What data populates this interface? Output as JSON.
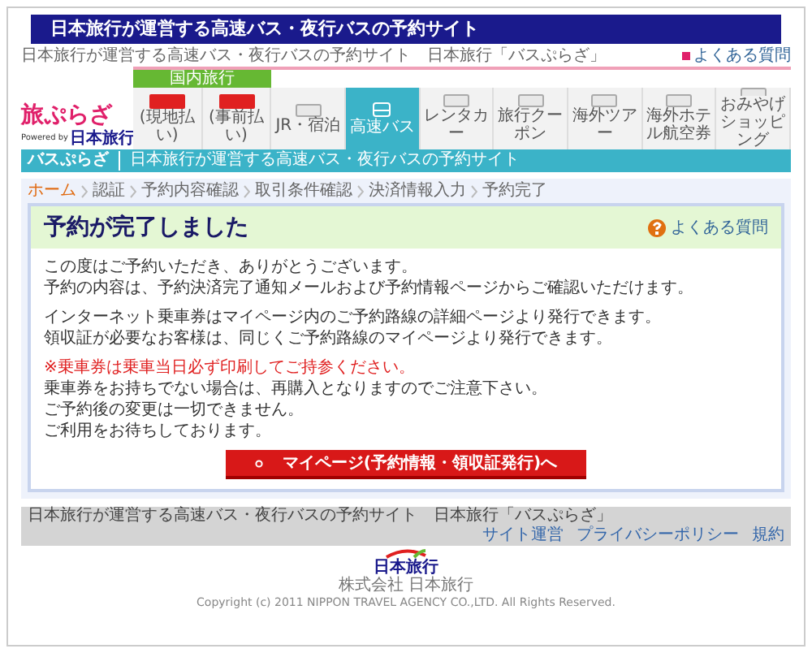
{
  "top_bar": {
    "title": "日本旅行が運営する高速バス・夜行バスの予約サイト"
  },
  "header": {
    "tagline": "日本旅行が運営する高速バス・夜行バスの予約サイト　日本旅行「バスぷらざ」",
    "faq_link": "よくある質問",
    "logo": "旅ぷらざ",
    "powered_by": "Powered by",
    "logo_brand": "日本旅行"
  },
  "nav": [
    {
      "kind": "group",
      "label": "国内旅行",
      "items": [
        {
          "kind": "badge",
          "label": "(現地払い)",
          "selected": false
        },
        {
          "kind": "badge",
          "label": "(事前払い)",
          "selected": false
        }
      ]
    },
    {
      "kind": "plain",
      "label": "JR・宿泊",
      "selected": false
    },
    {
      "kind": "bus",
      "label": "高速バス",
      "selected": true
    },
    {
      "kind": "plain",
      "label": "レンタカー",
      "selected": false
    },
    {
      "kind": "plain",
      "label": "旅行クーポン",
      "selected": false
    },
    {
      "kind": "plain",
      "label": "海外ツアー",
      "selected": false
    },
    {
      "kind": "plain",
      "label": "海外ホテル航空券",
      "selected": false
    },
    {
      "kind": "plain",
      "label": "おみやげショッピング",
      "selected": false
    }
  ],
  "sub_bar": {
    "site": "バスぷらざ",
    "description": "日本旅行が運営する高速バス・夜行バスの予約サイト"
  },
  "breadcrumb": [
    {
      "label": "ホーム",
      "link": true
    },
    {
      "label": "認証",
      "link": false
    },
    {
      "label": "予約内容確認",
      "link": false
    },
    {
      "label": "取引条件確認",
      "link": false
    },
    {
      "label": "決済情報入力",
      "link": false
    },
    {
      "label": "予約完了",
      "link": false
    }
  ],
  "card": {
    "title": "予約が完了しました",
    "faq_link": "よくある質問",
    "paragraphs": [
      {
        "kind": "normal",
        "lines": [
          "この度はご予約いただき、ありがとうございます。",
          "予約の内容は、予約決済完了通知メールおよび予約情報ページからご確認いただけます。"
        ]
      },
      {
        "kind": "normal",
        "lines": [
          "インターネット乗車券はマイページ内のご予約路線の詳細ページより発行できます。",
          "領収証が必要なお客様は、同じくご予約路線のマイページより発行できます。"
        ]
      },
      {
        "kind": "mixed",
        "lines": [
          "※乗車券は乗車当日必ず印刷してご持参ください。",
          "乗車券をお持ちでない場合は、再購入となりますのでご注意下さい。",
          "ご予約後の変更は一切できません。",
          "ご利用をお待ちしております。"
        ]
      }
    ],
    "button": "マイページ(予約情報・領収証発行)へ"
  },
  "footer": {
    "text": "日本旅行が運営する高速バス・夜行バスの予約サイト　日本旅行「バスぷらざ」",
    "links": [
      "サイト運営",
      "プライバシーポリシー",
      "規約"
    ],
    "logo": "日本旅行",
    "company": "株式会社 日本旅行",
    "copyright": "Copyright (c) 2011 NIPPON TRAVEL AGENCY CO.,LTD. All Rights Reserved."
  }
}
